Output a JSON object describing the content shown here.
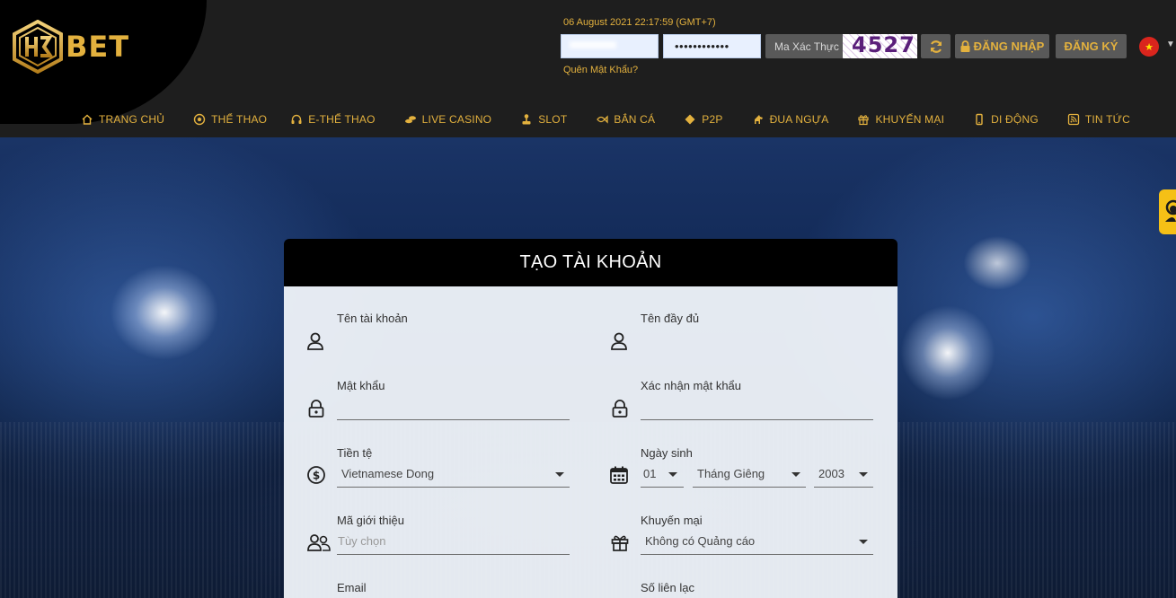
{
  "header": {
    "logo_text": "BET",
    "datetime": "06 August 2021 22:17:59 (GMT+7)",
    "forgot_password": "Quên Mật Khẩu?",
    "password_mask": "••••••••••••",
    "captcha_label": "Ma Xác Thực",
    "captcha_code": "4527",
    "login_label": "ĐĂNG NHẬP",
    "register_label": "ĐĂNG KÝ",
    "flag_star": "★",
    "lang_caret": "▼"
  },
  "nav": [
    {
      "label": "TRANG CHỦ",
      "icon": "home-icon"
    },
    {
      "label": "THỂ THAO",
      "icon": "soccer-ball-icon"
    },
    {
      "label": "E-THỂ THAO",
      "icon": "headset-icon"
    },
    {
      "label": "LIVE CASINO",
      "icon": "chips-icon"
    },
    {
      "label": "SLOT",
      "icon": "joystick-icon"
    },
    {
      "label": "BẮN CÁ",
      "icon": "fish-icon"
    },
    {
      "label": "P2P",
      "icon": "diamond-icon"
    },
    {
      "label": "ĐUA NGỰA",
      "icon": "horse-icon"
    },
    {
      "label": "KHUYẾN MẠI",
      "icon": "gift-icon"
    },
    {
      "label": "DI ĐỘNG",
      "icon": "mobile-icon"
    },
    {
      "label": "TIN TỨC",
      "icon": "rss-icon"
    }
  ],
  "form": {
    "title": "TẠO TÀI KHOẢN",
    "username_label": "Tên tài khoản",
    "fullname_label": "Tên đầy đủ",
    "password_label": "Mật khẩu",
    "confirm_password_label": "Xác nhận mật khẩu",
    "currency_label": "Tiền tệ",
    "currency_value": "Vietnamese Dong",
    "birthday_label": "Ngày sinh",
    "birth_day": "01",
    "birth_month": "Tháng Giêng",
    "birth_year": "2003",
    "referral_label": "Mã giới thiệu",
    "referral_placeholder": "Tùy chọn",
    "promo_label": "Khuyến mại",
    "promo_value": "Không có Quảng cáo",
    "email_label": "Email",
    "phone_label": "Số liên lạc"
  },
  "colors": {
    "accent": "#e3b13e",
    "header_bg": "#1e1e1e",
    "support_tab": "#f5c016"
  }
}
